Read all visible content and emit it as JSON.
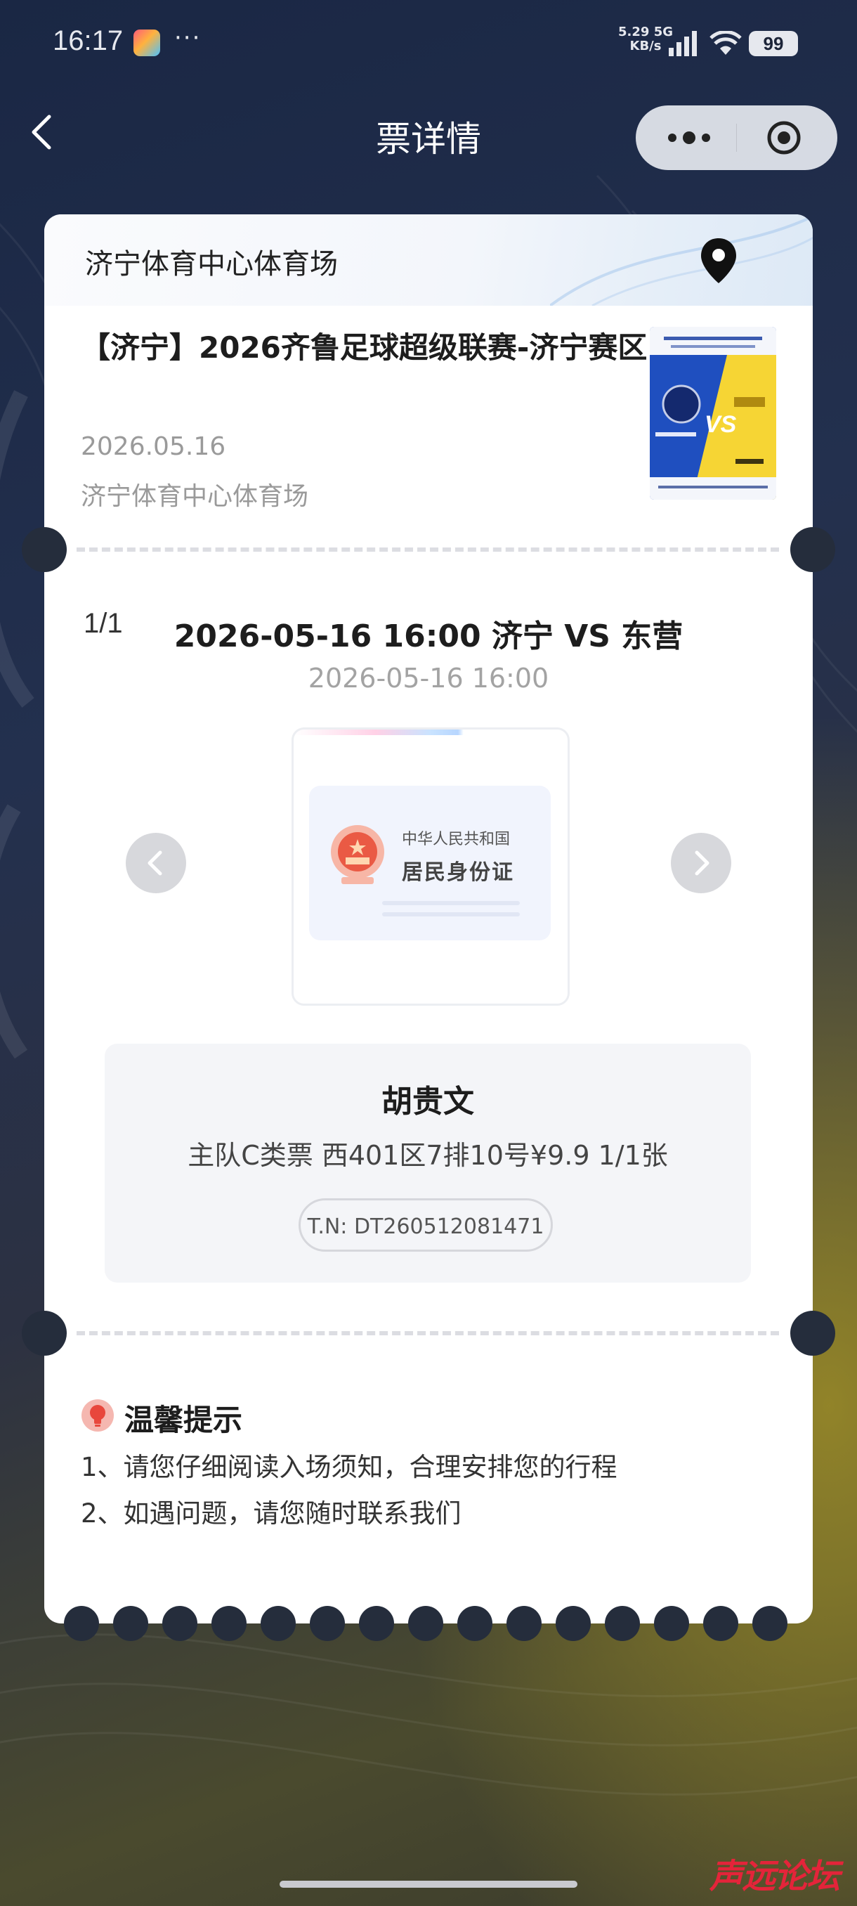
{
  "status_bar": {
    "time": "16:17",
    "dots": "···",
    "net_speed_line1": "5.29",
    "net_speed_line2": "KB/s",
    "net_type": "5G",
    "battery": "99"
  },
  "nav": {
    "title": "票详情"
  },
  "ticket": {
    "venue_header": "济宁体育中心体育场",
    "event_title": "【济宁】2026齐鲁足球超级联赛-济宁赛区",
    "event_date": "2026.05.16",
    "event_venue": "济宁体育中心体育场",
    "counter": "1/1",
    "match": "2026-05-16 16:00 济宁 VS 东营",
    "match_time": "2026-05-16 16:00",
    "id_card": {
      "line1": "中华人民共和国",
      "line2": "居民身份证"
    },
    "holder_name": "胡贵文",
    "seat_info": "主队C类票 西401区7排10号¥9.9 1/1张",
    "ticket_number": "T.N:  DT260512081471"
  },
  "tips": {
    "title": "温馨提示",
    "items": [
      "1、请您仔细阅读入场须知，合理安排您的行程",
      "2、如遇问题，请您随时联系我们"
    ]
  },
  "watermark": "声远论坛",
  "colors": {
    "accent_red": "#e4243a",
    "card_bg": "#ffffff",
    "poster_blue": "#1f4fbf",
    "poster_yellow": "#f6d534"
  }
}
